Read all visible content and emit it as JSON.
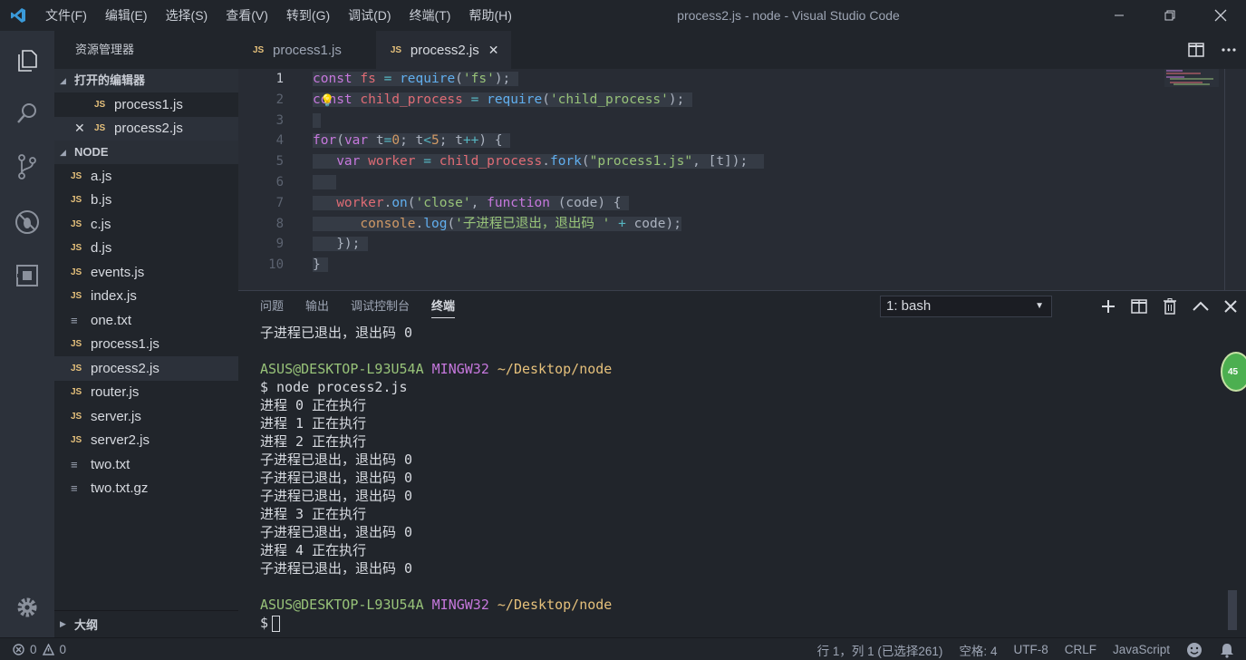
{
  "titlebar": {
    "menu": [
      "文件(F)",
      "编辑(E)",
      "选择(S)",
      "查看(V)",
      "转到(G)",
      "调试(D)",
      "终端(T)",
      "帮助(H)"
    ],
    "title": "process2.js - node - Visual Studio Code"
  },
  "sidebar": {
    "title": "资源管理器",
    "open_editors_label": "打开的编辑器",
    "open_editors": [
      "process1.js",
      "process2.js"
    ],
    "folder_label": "NODE",
    "files": [
      {
        "name": "a.js",
        "type": "js"
      },
      {
        "name": "b.js",
        "type": "js"
      },
      {
        "name": "c.js",
        "type": "js"
      },
      {
        "name": "d.js",
        "type": "js"
      },
      {
        "name": "events.js",
        "type": "js"
      },
      {
        "name": "index.js",
        "type": "js"
      },
      {
        "name": "one.txt",
        "type": "txt"
      },
      {
        "name": "process1.js",
        "type": "js"
      },
      {
        "name": "process2.js",
        "type": "js"
      },
      {
        "name": "router.js",
        "type": "js"
      },
      {
        "name": "server.js",
        "type": "js"
      },
      {
        "name": "server2.js",
        "type": "js"
      },
      {
        "name": "two.txt",
        "type": "txt"
      },
      {
        "name": "two.txt.gz",
        "type": "txt"
      }
    ],
    "outline_label": "大纲",
    "js_badge": "JS"
  },
  "tabs": [
    {
      "label": "process1.js"
    },
    {
      "label": "process2.js"
    }
  ],
  "editor": {
    "line_numbers": [
      "1",
      "2",
      "3",
      "4",
      "5",
      "6",
      "7",
      "8",
      "9",
      "10"
    ]
  },
  "panel": {
    "tabs": [
      "问题",
      "输出",
      "调试控制台",
      "终端"
    ],
    "terminal_select": "1: bash",
    "prompt_user": "ASUS@DESKTOP-L93U54A",
    "prompt_ming": "MINGW32",
    "prompt_path": "~/Desktop/node",
    "lines": {
      "l0": "子进程已退出，退出码 0",
      "cmd": "$ node process2.js",
      "l1": "进程 0 正在执行",
      "l2": "进程 1 正在执行",
      "l3": "进程 2 正在执行",
      "l4": "子进程已退出，退出码 0",
      "l5": "子进程已退出，退出码 0",
      "l6": "子进程已退出，退出码 0",
      "l7": "进程 3 正在执行",
      "l8": "子进程已退出，退出码 0",
      "l9": "进程 4 正在执行",
      "l10": "子进程已退出，退出码 0",
      "final_prompt": "$"
    }
  },
  "status": {
    "errors": "0",
    "warnings": "0",
    "position": "行 1，列 1 (已选择261)",
    "spaces": "空格: 4",
    "encoding": "UTF-8",
    "eol": "CRLF",
    "language": "JavaScript"
  },
  "edge_badge": "45"
}
